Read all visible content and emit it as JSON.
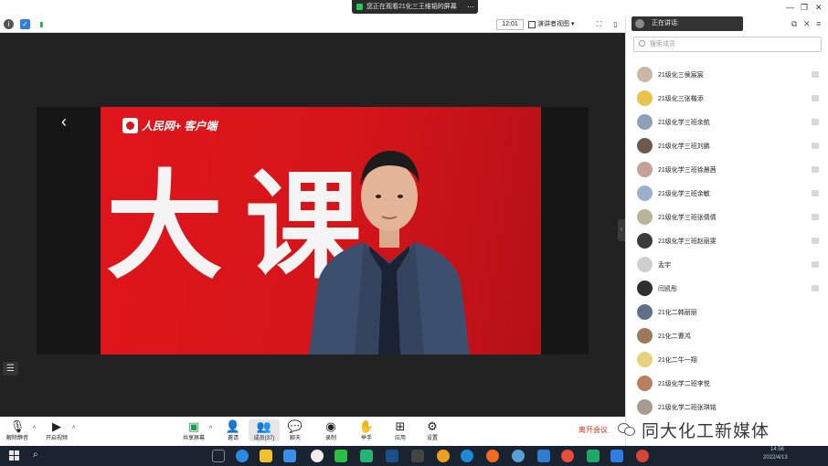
{
  "share_notice": {
    "text": "您正在观看21化三王维韬的屏幕"
  },
  "meeting_bar": {
    "timer": "12:01",
    "view_label": "演讲者视图"
  },
  "video": {
    "app_name": "人民网+ 客户端",
    "big_text": [
      "大",
      "课"
    ]
  },
  "toolbar": {
    "items": [
      {
        "label": "解除静音",
        "icon": "mic-muted-icon"
      },
      {
        "label": "开启视频",
        "icon": "video-off-icon"
      },
      {
        "label": "共享屏幕",
        "icon": "share-screen-icon"
      },
      {
        "label": "邀请",
        "icon": "invite-icon"
      },
      {
        "label": "成员(37)",
        "icon": "members-icon"
      },
      {
        "label": "聊天",
        "icon": "chat-icon"
      },
      {
        "label": "录制",
        "icon": "record-icon"
      },
      {
        "label": "举手",
        "icon": "raise-hand-icon"
      },
      {
        "label": "应用",
        "icon": "apps-icon"
      },
      {
        "label": "设置",
        "icon": "settings-icon"
      }
    ],
    "leave_label": "离开会议"
  },
  "panel": {
    "speaking_label": "正在讲话:",
    "search_placeholder": "搜索成员",
    "participants": [
      {
        "name": "21级化三侯宸宸",
        "color": "#c9b7a3"
      },
      {
        "name": "21级化三张楷添",
        "color": "#e9c34a"
      },
      {
        "name": "21级化学三班余航",
        "color": "#8ea0b5"
      },
      {
        "name": "21级化学三班刘鹏",
        "color": "#6d5a4b"
      },
      {
        "name": "21级化学三班徐晨茜",
        "color": "#c2a296"
      },
      {
        "name": "21级化学三班余敏",
        "color": "#9ab0cc"
      },
      {
        "name": "21级化学三班张倩倩",
        "color": "#b8b39a"
      },
      {
        "name": "21级化学三班赵丽雯",
        "color": "#3b3b3b"
      },
      {
        "name": "孟宇",
        "color": "#cfcfcf"
      },
      {
        "name": "闫凯彤",
        "color": "#2f2f2f"
      },
      {
        "name": "21化二韩丽丽",
        "color": "#5e6f86"
      },
      {
        "name": "21化二曹鸿",
        "color": "#9b7a5a"
      },
      {
        "name": "21化二牛一翔",
        "color": "#e6d27a"
      },
      {
        "name": "21级化学二班李悦",
        "color": "#b77f5f"
      },
      {
        "name": "21级化学二班张琪铭",
        "color": "#a89c8f"
      }
    ]
  },
  "watermark": {
    "text": "同大化工新媒体"
  },
  "taskbar": {
    "time": "14:56",
    "date": "2022/4/13"
  }
}
